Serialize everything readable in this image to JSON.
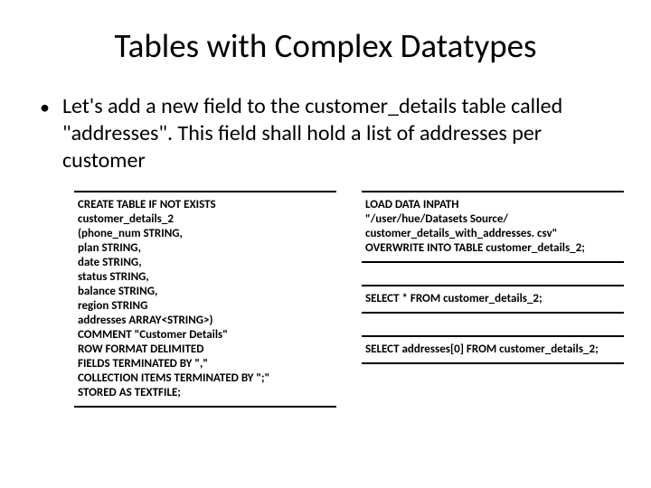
{
  "title": "Tables with Complex Datatypes",
  "bullet": "Let's add a new field to the customer_details table called \"addresses\". This field shall hold a list of addresses per customer",
  "left": {
    "create": "CREATE TABLE IF NOT EXISTS\ncustomer_details_2\n(phone_num STRING,\nplan STRING,\ndate STRING,\nstatus STRING,\nbalance STRING,\nregion STRING\naddresses ARRAY<STRING>)\nCOMMENT \"Customer Details\"\nROW FORMAT DELIMITED\nFIELDS TERMINATED BY \",\"\nCOLLECTION ITEMS TERMINATED BY \";\"\nSTORED AS TEXTFILE;"
  },
  "right": {
    "load": "LOAD DATA INPATH\n\"/user/hue/Datasets Source/\ncustomer_details_with_addresses. csv\"\nOVERWRITE INTO TABLE customer_details_2;",
    "select_all": "SELECT * FROM customer_details_2;",
    "select_idx": "SELECT addresses[0] FROM customer_details_2;"
  }
}
